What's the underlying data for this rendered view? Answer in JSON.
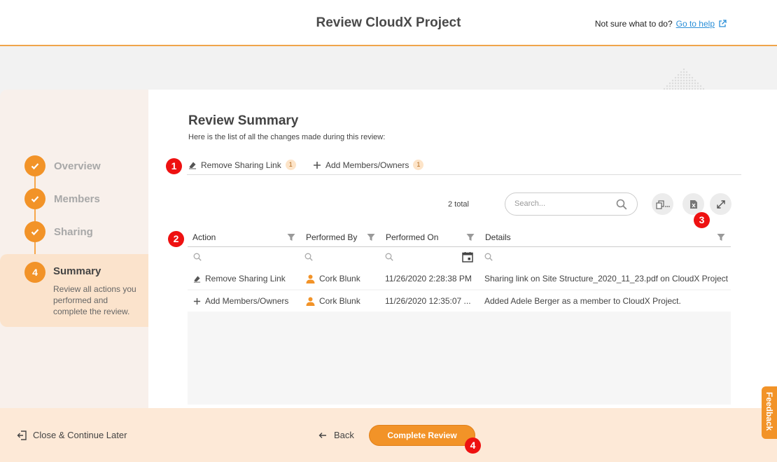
{
  "header": {
    "title": "Review CloudX Project",
    "help_prompt": "Not sure what to do?",
    "help_link": "Go to help"
  },
  "steps": [
    {
      "label": "Overview",
      "state": "done"
    },
    {
      "label": "Members",
      "state": "done"
    },
    {
      "label": "Sharing",
      "state": "done"
    },
    {
      "number": "4",
      "label": "Summary",
      "state": "active",
      "description": "Review all actions you performed and complete the review."
    }
  ],
  "summary": {
    "title": "Review Summary",
    "subtitle": "Here is the list of all the changes made during this review:",
    "tabs": [
      {
        "label": "Remove Sharing Link",
        "count": "1",
        "icon": "eraser-icon"
      },
      {
        "label": "Add Members/Owners",
        "count": "1",
        "icon": "plus-icon"
      }
    ],
    "total": "2 total",
    "search_placeholder": "Search...",
    "columns": [
      "Action",
      "Performed By",
      "Performed On",
      "Details"
    ],
    "rows": [
      {
        "action": "Remove Sharing Link",
        "action_icon": "eraser-icon",
        "performed_by": "Cork Blunk",
        "performed_on": "11/26/2020 2:28:38 PM",
        "details": "Sharing link on Site Structure_2020_11_23.pdf on CloudX Project"
      },
      {
        "action": "Add Members/Owners",
        "action_icon": "plus-icon",
        "performed_by": "Cork Blunk",
        "performed_on": "11/26/2020 12:35:07 ...",
        "details": "Added Adele Berger as a member to CloudX Project."
      }
    ]
  },
  "footer": {
    "close_label": "Close & Continue Later",
    "back_label": "Back",
    "complete_label": "Complete Review"
  },
  "feedback_label": "Feedback",
  "markers": [
    "1",
    "2",
    "3",
    "4"
  ],
  "colors": {
    "accent": "#f29328",
    "link": "#2a8fd8",
    "marker": "#e11111"
  }
}
